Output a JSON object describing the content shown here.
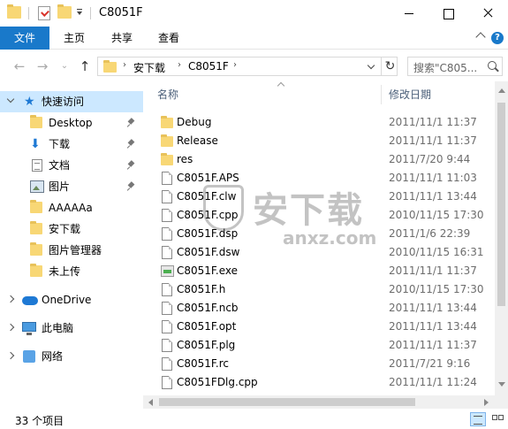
{
  "window": {
    "title": "C8051F"
  },
  "ribbon": {
    "tabs": [
      {
        "label": "文件",
        "active": true
      },
      {
        "label": "主页",
        "active": false
      },
      {
        "label": "共享",
        "active": false
      },
      {
        "label": "查看",
        "active": false
      }
    ],
    "help_glyph": "?"
  },
  "address": {
    "crumbs": [
      "安下载",
      "C8051F"
    ],
    "search_placeholder": "搜索\"C805..."
  },
  "sidebar": {
    "quick_access": "快速访问",
    "pinned": [
      "Desktop",
      "下载",
      "文档",
      "图片"
    ],
    "recent": [
      "AAAAAa",
      "安下载",
      "图片管理器",
      "未上传"
    ],
    "onedrive": "OneDrive",
    "this_pc": "此电脑",
    "network": "网络"
  },
  "columns": {
    "name": "名称",
    "date": "修改日期"
  },
  "files": [
    {
      "name": "Debug",
      "date": "2011/11/1 11:37",
      "kind": "folder"
    },
    {
      "name": "Release",
      "date": "2011/11/1 11:37",
      "kind": "folder"
    },
    {
      "name": "res",
      "date": "2011/7/20 9:44",
      "kind": "folder"
    },
    {
      "name": "C8051F.APS",
      "date": "2011/11/1 11:03",
      "kind": "file"
    },
    {
      "name": "C8051F.clw",
      "date": "2011/11/1 13:44",
      "kind": "file"
    },
    {
      "name": "C8051F.cpp",
      "date": "2010/11/15 17:30",
      "kind": "file"
    },
    {
      "name": "C8051F.dsp",
      "date": "2011/1/6 22:39",
      "kind": "file"
    },
    {
      "name": "C8051F.dsw",
      "date": "2010/11/15 16:31",
      "kind": "file"
    },
    {
      "name": "C8051F.exe",
      "date": "2011/11/1 11:37",
      "kind": "exe"
    },
    {
      "name": "C8051F.h",
      "date": "2010/11/15 17:30",
      "kind": "file"
    },
    {
      "name": "C8051F.ncb",
      "date": "2011/11/1 13:44",
      "kind": "file"
    },
    {
      "name": "C8051F.opt",
      "date": "2011/11/1 13:44",
      "kind": "file"
    },
    {
      "name": "C8051F.plg",
      "date": "2011/11/1 11:37",
      "kind": "file"
    },
    {
      "name": "C8051F.rc",
      "date": "2011/7/21 9:16",
      "kind": "file"
    },
    {
      "name": "C8051FDlg.cpp",
      "date": "2011/11/1 11:24",
      "kind": "file"
    }
  ],
  "status": {
    "count": "33 个项目"
  },
  "watermark": {
    "text": "安下载",
    "url": "anxz.com"
  },
  "colors": {
    "accent": "#1979ca",
    "folder": "#f8d775",
    "selection": "#cce8ff"
  }
}
